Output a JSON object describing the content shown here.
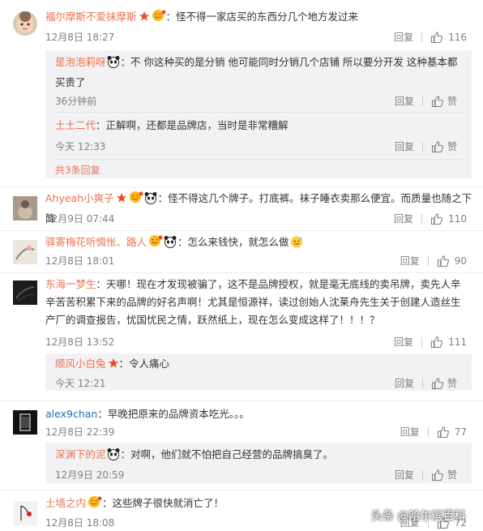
{
  "comments": [
    {
      "user": "福尔摩斯不爱抹摩斯",
      "text": "：怪不得一家店买的东西分几个地方发过来",
      "time": "12月8日 18:27",
      "reply": "回复",
      "likes": "116",
      "replies": [
        {
          "user": "是泡泡莉呀",
          "text": "：不 你这种买的是分销 他可能同时分销几个店铺 所以要分开发 这种基本都买贵了",
          "time": "36分钟前",
          "reply": "回复",
          "likes": "赞"
        },
        {
          "user": "土土二代",
          "text": "：正解啊，还都是品牌店，当时是非常糟解",
          "time": "今天 12:33",
          "reply": "回复",
          "likes": "赞"
        }
      ],
      "more": "共3条回复"
    },
    {
      "user": "Ahyeah小爽子",
      "text": "：怪不得这几个牌子。打底裤。袜子睡衣卖那么便宜。而质量也随之下降",
      "time": "12月9日 07:44",
      "reply": "回复",
      "likes": "110"
    },
    {
      "user": "驿寄梅花听惆怅、路人",
      "text": "：怎么来钱快，就怎么做",
      "time": "12月8日 18:01",
      "reply": "回复",
      "likes": "90"
    },
    {
      "user": "东海一梦生",
      "text": "：天哪！现在才发现被骗了，这不是品牌授权，就是毫无底线的卖吊牌，卖先人辛辛苦苦积累下来的品牌的好名声啊！尤其是恒源祥，读过创始人沈莱舟先生关于创建人造丝生产厂的调查报告，忧国忧民之情，跃然纸上，现在怎么变成这样了！！！？",
      "time": "12月8日 13:52",
      "reply": "回复",
      "likes": "111",
      "replies": [
        {
          "user": "顺风小白兔",
          "text": "：令人痛心",
          "time": "今天 12:21",
          "reply": "回复",
          "likes": "赞"
        }
      ]
    },
    {
      "user": "alex9chan",
      "text": "：早晚把原来的品牌资本吃光。。。",
      "time": "12月8日 22:39",
      "reply": "回复",
      "likes": "77",
      "replies": [
        {
          "user": "深渊下的泥",
          "text": "：对啊，他们就不怕把自己经营的品牌搞臭了。",
          "time": "12月9日 20:59",
          "reply": "回复",
          "likes": "赞"
        }
      ]
    },
    {
      "user": "土墙之内",
      "text": "：这些牌子很快就消亡了！",
      "time": "12月8日 18:08",
      "reply": "回复",
      "likes": "72"
    }
  ],
  "watermark": "头条 @哈尔滨百科",
  "colors": {
    "username": "#eb7350",
    "username_blue": "#1e6fbf",
    "meta": "#808080",
    "subbox_bg": "#f2f2f5"
  }
}
